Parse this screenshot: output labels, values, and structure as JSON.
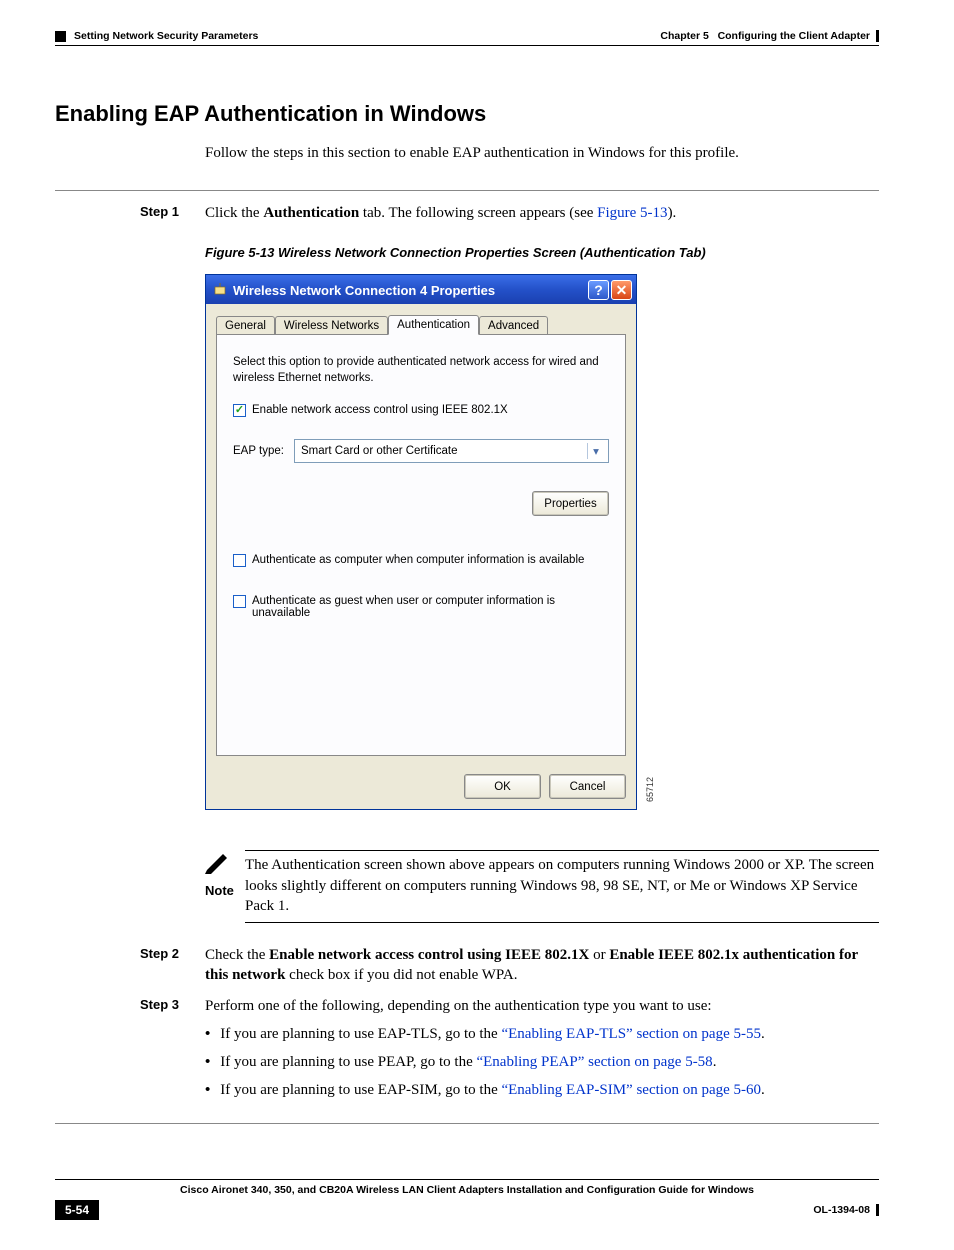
{
  "header": {
    "chapter_label": "Chapter 5",
    "chapter_title": "Configuring the Client Adapter",
    "section": "Setting Network Security Parameters"
  },
  "h2": "Enabling EAP Authentication in Windows",
  "intro": "Follow the steps in this section to enable EAP authentication in Windows for this profile.",
  "step1": {
    "label": "Step 1",
    "t1": "Click the ",
    "bold1": "Authentication",
    "t2": " tab. The following screen appears (see ",
    "link": "Figure 5-13",
    "t3": ")."
  },
  "figure_caption": "Figure 5-13   Wireless Network Connection Properties Screen (Authentication Tab)",
  "dialog": {
    "title": "Wireless Network Connection 4 Properties",
    "tabs": {
      "general": "General",
      "wireless": "Wireless Networks",
      "auth": "Authentication",
      "advanced": "Advanced"
    },
    "desc": "Select this option to provide authenticated network access for wired and wireless Ethernet networks.",
    "chk_enable": "Enable network access control using IEEE 802.1X",
    "eap_type_label": "EAP type:",
    "eap_type_value": "Smart Card or other Certificate",
    "properties_btn": "Properties",
    "chk_computer": "Authenticate as computer when computer information is available",
    "chk_guest": "Authenticate as guest when user or computer information is unavailable",
    "ok": "OK",
    "cancel": "Cancel",
    "fig_num": "65712"
  },
  "note": {
    "label": "Note",
    "text": "The Authentication screen shown above appears on computers running Windows 2000 or XP. The screen looks slightly different on computers running Windows 98, 98 SE, NT, or Me or Windows XP Service Pack 1."
  },
  "step2": {
    "label": "Step 2",
    "t1": "Check the ",
    "b1": "Enable network access control using IEEE 802.1X",
    "t2": " or ",
    "b2": "Enable IEEE 802.1x authentication for this network",
    "t3": " check box if you did not enable WPA."
  },
  "step3": {
    "label": "Step 3",
    "intro": "Perform one of the following, depending on the authentication type you want to use:",
    "b1a": "If you are planning to use EAP-TLS, go to the ",
    "b1link": "“Enabling EAP-TLS” section on page 5-55",
    "b1b": ".",
    "b2a": "If you are planning to use PEAP, go to the ",
    "b2link": "“Enabling PEAP” section on page 5-58",
    "b2b": ".",
    "b3a": "If you are planning to use EAP-SIM, go to the ",
    "b3link": "“Enabling EAP-SIM” section on page 5-60",
    "b3b": "."
  },
  "footer": {
    "book": "Cisco Aironet 340, 350, and CB20A Wireless LAN Client Adapters Installation and Configuration Guide for Windows",
    "page": "5-54",
    "doc_id": "OL-1394-08"
  }
}
